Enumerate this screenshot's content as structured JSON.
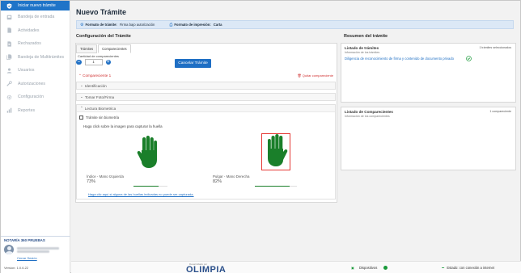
{
  "sidebar": {
    "items": [
      {
        "label": "Iniciar nuevo trámite",
        "icon": "shield-icon",
        "active": true
      },
      {
        "label": "Bandeja de entrada",
        "icon": "inbox-icon"
      },
      {
        "label": "Actividades",
        "icon": "document-icon"
      },
      {
        "label": "Rechazados",
        "icon": "document-x-icon"
      },
      {
        "label": "Bandeja de Multitrámites",
        "icon": "document-stack-icon"
      },
      {
        "label": "Usuarios",
        "icon": "user-icon"
      },
      {
        "label": "Autorizaciones",
        "icon": "tools-icon"
      },
      {
        "label": "Configuración",
        "icon": "gear-icon"
      },
      {
        "label": "Reportes",
        "icon": "chart-icon"
      }
    ],
    "notary": {
      "title": "NOTARÍA 360 PRUEBAS",
      "logout": "Cerrar Sesión"
    },
    "version": "Version: 1.0.6.22"
  },
  "main": {
    "title": "Nuevo Trámite",
    "info_bar": {
      "format_label": "Formato de trámite:",
      "format_value": "Firma bajo autorización",
      "print_label": "Formato de impresión:",
      "print_value": "Carta"
    },
    "config": {
      "title": "Configuración del Trámite",
      "tabs": [
        "Trámites",
        "Comparecientes"
      ],
      "active_tab": 1,
      "quantity_label": "Cantidad de comparecientes",
      "quantity_value": "1",
      "minus": "−",
      "plus": "+",
      "cancel_button": "Cancelar Trámite",
      "compareciente_label": "Compareciente 1",
      "delete_label": "Quitar compareciente",
      "accordions": [
        "Identificación",
        "Tomar Foto/Firma"
      ],
      "biometric": {
        "title": "Lectura Biometrica",
        "checkbox_label": "Trámite sin biometría",
        "checked": false,
        "hint": "Haga click sobre la imagen para capturar la huella",
        "left": {
          "label": "Índice - Mano Izquierda",
          "pct_text": "73%",
          "pct": 0.73
        },
        "right": {
          "label": "Pulgar - Mano Derecha",
          "pct_text": "82%",
          "pct": 0.82
        },
        "help_link": "Haga clic aquí si alguna de las huellas indicadas no puede ser capturada."
      }
    }
  },
  "summary": {
    "title": "Resumen del trámite",
    "tramites": {
      "title": "Listado de trámites",
      "subtitle": "Información de los trámites",
      "count": "1 trámites seleccionados",
      "item": "Diligencia de reconocimiento de firma y contenido de documento privado"
    },
    "comparecientes": {
      "title": "Listado de Comparecientes",
      "subtitle": "Información de los comparecientes",
      "count": "1 compareciente"
    }
  },
  "status": {
    "brand_small": "Desarrollado por",
    "brand": "OLIMPIA",
    "devices_label": "Dispositivos",
    "connection_label": "Estado: con conexión a internet"
  },
  "colors": {
    "accent": "#1f74c8",
    "hand_green": "#1a7f2a",
    "danger": "#d03030"
  }
}
